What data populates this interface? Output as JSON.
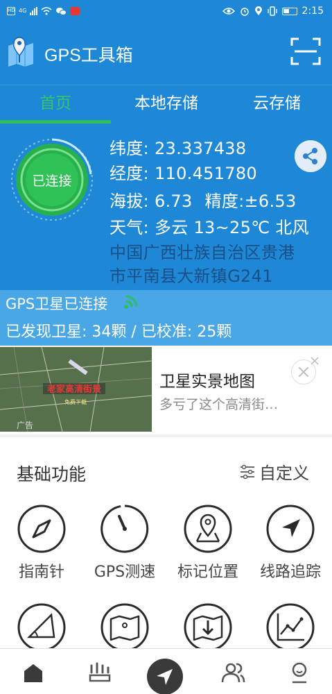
{
  "status_bar": {
    "network": "4G",
    "time": "2:15"
  },
  "app": {
    "title": "GPS工具箱",
    "logo_icon": "map-pin-logo-icon",
    "scan_icon": "scan-icon"
  },
  "tabs": [
    {
      "label": "首页",
      "active": true
    },
    {
      "label": "本地存储",
      "active": false
    },
    {
      "label": "云存储",
      "active": false
    }
  ],
  "connection": {
    "status": "已连接",
    "accent": "#2fbf5c"
  },
  "location": {
    "latitude_label": "纬度:",
    "latitude": "23.337438",
    "longitude_label": "经度:",
    "longitude": "110.451780",
    "altitude_label": "海拔:",
    "altitude": "6.73",
    "accuracy_label": "精度:",
    "accuracy": "±6.53",
    "weather_label": "天气:",
    "weather": "多云 13~25℃ 北风",
    "address_line1": "中国广西壮族自治区贵港",
    "address_line2": "市平南县大新镇G241"
  },
  "gps": {
    "title": "GPS卫星已连接",
    "found_label": "已发现卫星:",
    "found": "34颗",
    "calibrated_label": "已校准:",
    "calibrated": "25颗",
    "summary": "已发现卫星: 34颗 / 已校准: 25颗"
  },
  "ad": {
    "tag": "广告",
    "title": "卫星实景地图",
    "description": "多亏了这个高清街…",
    "image_caption": "老家高清街景",
    "image_subcaption": "免费下载"
  },
  "basic_functions": {
    "title": "基础功能",
    "customize_label": "自定义",
    "items": [
      {
        "label": "指南针",
        "icon": "compass-icon"
      },
      {
        "label": "GPS测速",
        "icon": "speedometer-icon"
      },
      {
        "label": "标记位置",
        "icon": "map-marker-icon"
      },
      {
        "label": "线路追踪",
        "icon": "navigation-arrow-icon"
      },
      {
        "label": "",
        "icon": "protractor-icon"
      },
      {
        "label": "",
        "icon": "folded-map-icon"
      },
      {
        "label": "",
        "icon": "map-download-icon"
      },
      {
        "label": "",
        "icon": "line-chart-icon"
      }
    ]
  },
  "bottom_nav": [
    {
      "icon": "home-icon"
    },
    {
      "icon": "users-group-icon"
    },
    {
      "icon": "navigation-icon"
    },
    {
      "icon": "contacts-icon"
    },
    {
      "icon": "profile-icon"
    }
  ],
  "colors": {
    "primary": "#1e88d6",
    "strip": "#4aa7e6",
    "green": "#2fbf5c",
    "address": "#1a4f87"
  }
}
